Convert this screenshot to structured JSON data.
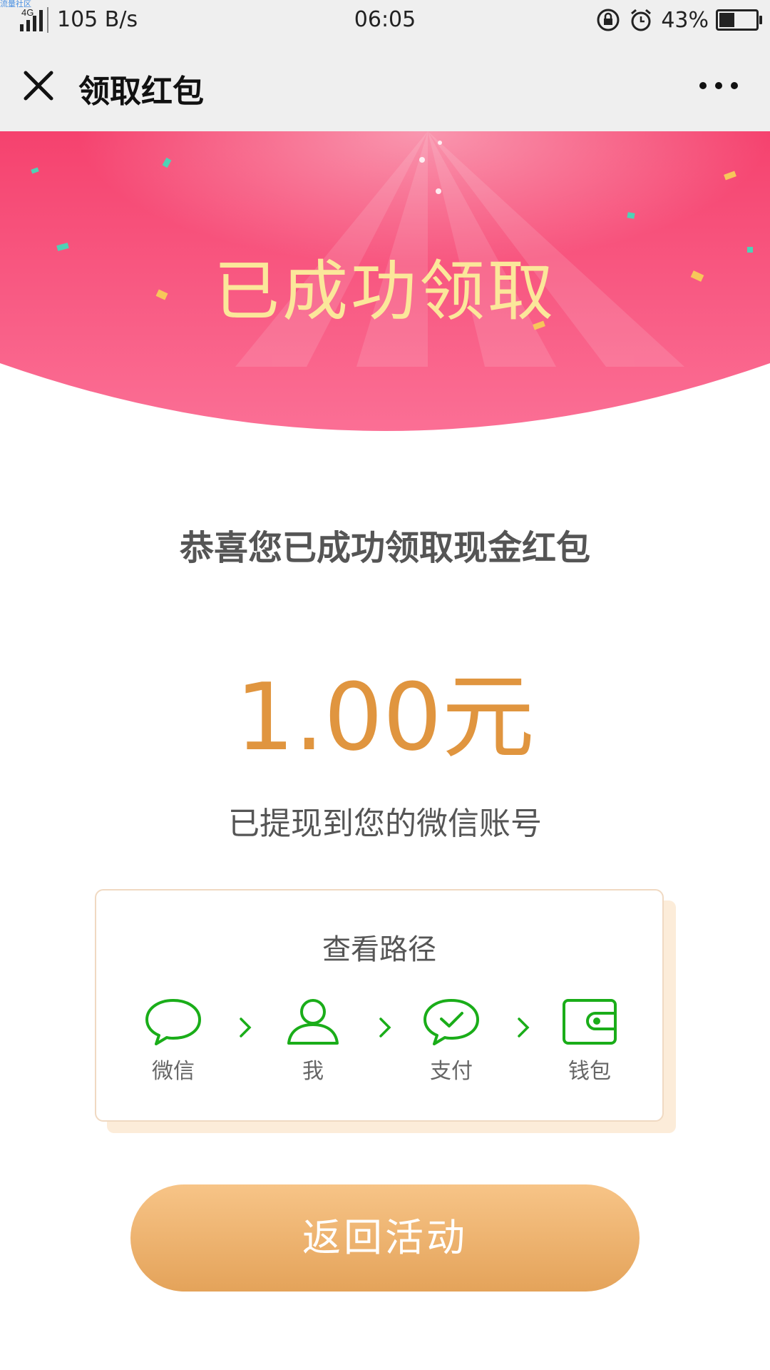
{
  "status_bar": {
    "network": "4G",
    "speed": "105 B/s",
    "time": "06:05",
    "battery": "43%",
    "battery_level": 0.43,
    "watermark": "流量社区"
  },
  "header": {
    "title": "领取红包",
    "close_icon": "close-icon",
    "more_icon": "more-dots-icon"
  },
  "banner": {
    "title": "已成功领取",
    "colors": {
      "top": "#f5426e",
      "bottom": "#fb6f95",
      "title": "#fbe79a"
    }
  },
  "main": {
    "congrats_text": "恭喜您已成功领取现金红包",
    "amount": "1.00元",
    "withdraw_text": "已提现到您的微信账号"
  },
  "path_card": {
    "title": "查看路径",
    "steps": [
      {
        "label": "微信",
        "icon": "chat-bubble-icon"
      },
      {
        "label": "我",
        "icon": "user-icon"
      },
      {
        "label": "支付",
        "icon": "pay-check-icon"
      },
      {
        "label": "钱包",
        "icon": "wallet-icon"
      }
    ],
    "accent_color": "#1aad19"
  },
  "actions": {
    "return_label": "返回活动"
  }
}
